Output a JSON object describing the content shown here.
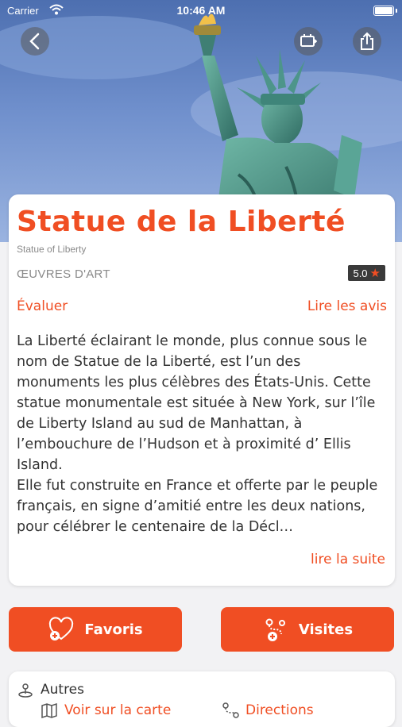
{
  "status_bar": {
    "carrier": "Carrier",
    "time": "10:46 AM"
  },
  "header": {
    "back_icon": "chevron-left-icon",
    "map_icon": "map-card-icon",
    "share_icon": "share-icon"
  },
  "place": {
    "title": "Statue de la Liberté",
    "subtitle": "Statue of Liberty",
    "category": "ŒUVRES D'ART",
    "rating": "5.0",
    "rate_label": "Évaluer",
    "reviews_label": "Lire les avis",
    "description": "La Liberté éclairant le monde, plus connue sous le nom de Statue de la Liberté, est l’un des monuments les plus célèbres des États-Unis. Cette statue monumentale est située à New York, sur l’île de Liberty Island au sud de Manhattan, à l’embouchure de l’Hudson et à proximité d’ Ellis Island.\nElle fut construite en France et offerte par le peuple français, en signe d’amitié entre les deux nations, pour célébrer le centenaire de la Décl…",
    "read_more_label": "lire la suite"
  },
  "actions": {
    "favorites_label": "Favoris",
    "visits_label": "Visites"
  },
  "info": {
    "others_label": "Autres",
    "map_label": "Voir sur la carte",
    "directions_label": "Directions"
  },
  "colors": {
    "accent": "#f04e23",
    "rating_bg": "#3a3a3a"
  }
}
